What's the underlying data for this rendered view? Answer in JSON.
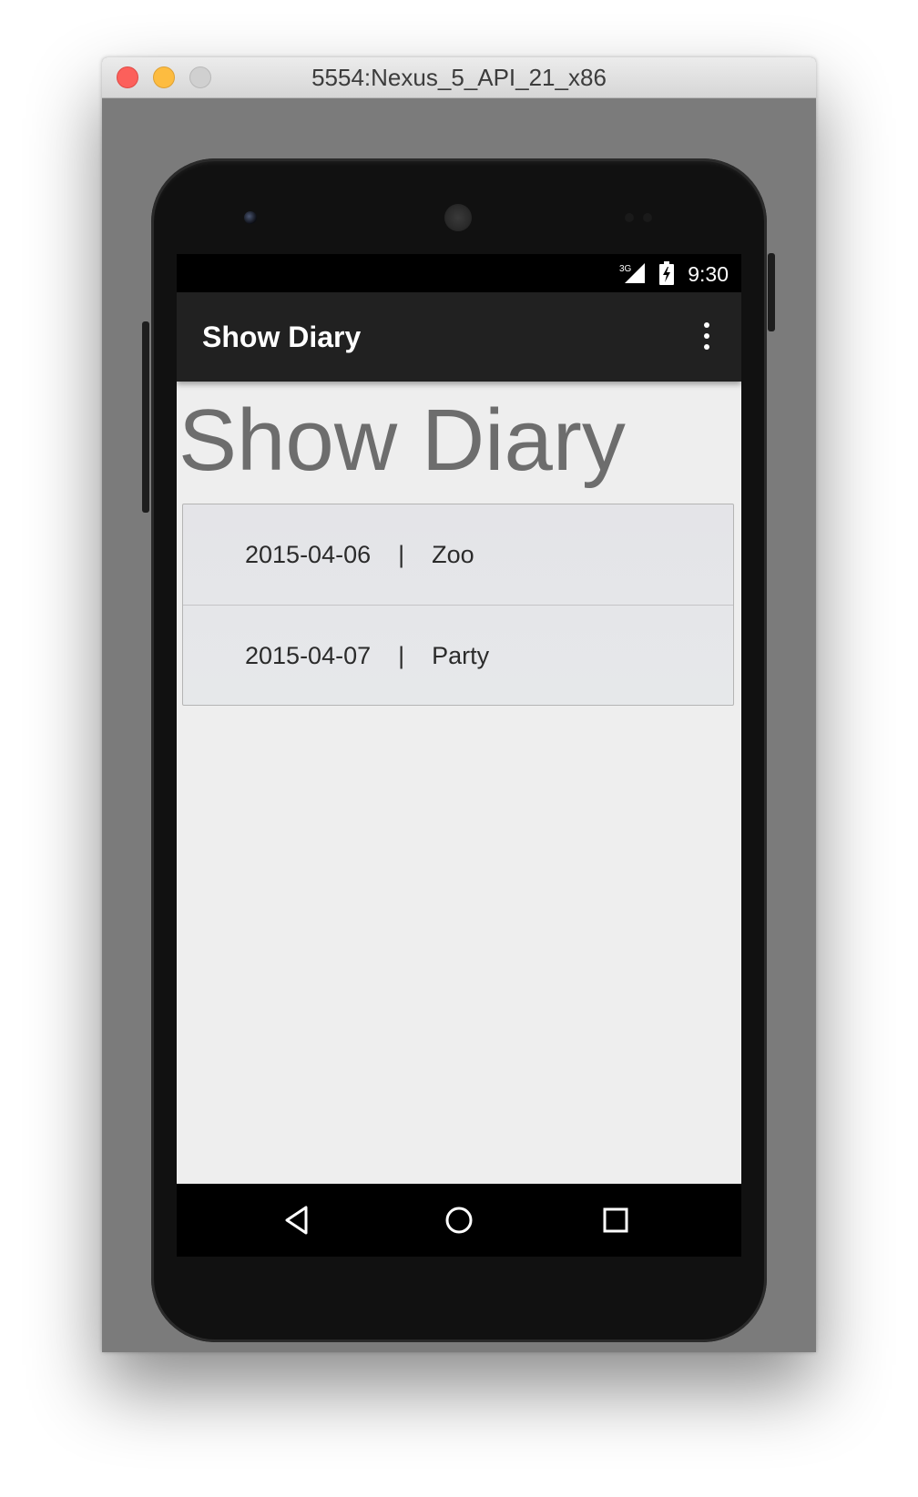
{
  "window": {
    "title": "5554:Nexus_5_API_21_x86"
  },
  "status_bar": {
    "time": "9:30",
    "network_type": "3G",
    "signal_icon": "signal-icon",
    "battery_icon": "battery-charging-icon"
  },
  "app_bar": {
    "title": "Show Diary",
    "menu_icon": "overflow-menu-icon"
  },
  "content": {
    "heading": "Show Diary",
    "entries": [
      {
        "text": "2015-04-06    |    Zoo"
      },
      {
        "text": "2015-04-07    |    Party"
      }
    ]
  },
  "nav_bar": {
    "back_icon": "back-icon",
    "home_icon": "home-icon",
    "recents_icon": "recents-icon"
  }
}
